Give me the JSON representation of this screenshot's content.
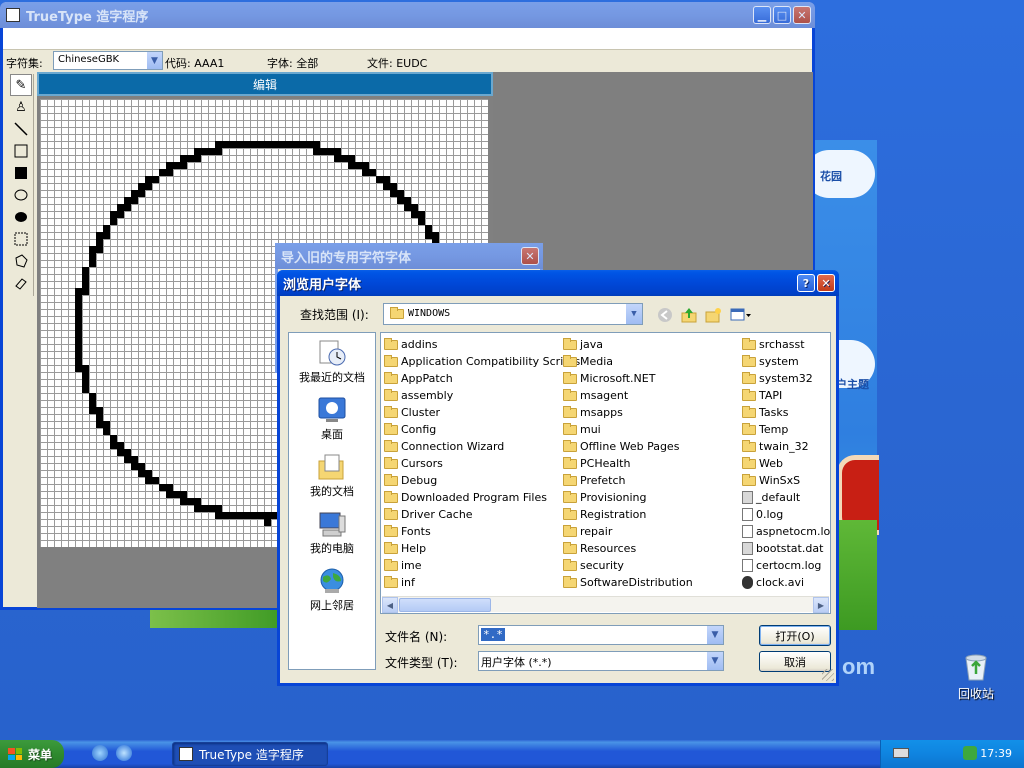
{
  "desktop": {
    "wallpaper_text_1": "花园",
    "wallpaper_text_2": "户主题",
    "wallpaper_brand": "om",
    "recycle_bin_label": "回收站"
  },
  "main_window": {
    "title": "TrueType 造字程序",
    "charset_label": "字符集:",
    "charset_value": "ChineseGBK",
    "code_label": "代码: AAA1",
    "font_label": "字体: 全部",
    "file_label": "文件: EUDC",
    "editor_header": "编辑",
    "tools": [
      "pencil-icon",
      "brush-icon",
      "line-icon",
      "hollow-rect-icon",
      "filled-rect-icon",
      "hollow-ellipse-icon",
      "filled-ellipse-icon",
      "rect-select-icon",
      "freeform-select-icon",
      "eraser-icon"
    ]
  },
  "import_dialog": {
    "title": "导入旧的专用字符字体"
  },
  "browse_dialog": {
    "title": "浏览用户字体",
    "look_in_label": "查找范围 (I):",
    "look_in_value": "WINDOWS",
    "places": [
      "我最近的文档",
      "桌面",
      "我的文档",
      "我的电脑",
      "网上邻居"
    ],
    "files": {
      "col1": [
        "addins",
        "Application Compatibility Scripts",
        "AppPatch",
        "assembly",
        "Cluster",
        "Config",
        "Connection Wizard",
        "Cursors",
        "Debug",
        "Downloaded Program Files",
        "Driver Cache",
        "Fonts",
        "Help",
        "ime",
        "inf"
      ],
      "col2": [
        "java",
        "Media",
        "Microsoft.NET",
        "msagent",
        "msapps",
        "mui",
        "Offline Web Pages",
        "PCHealth",
        "Prefetch",
        "Provisioning",
        "Registration",
        "repair",
        "Resources",
        "security",
        "SoftwareDistribution"
      ],
      "col3": [
        "srchasst",
        "system",
        "system32",
        "TAPI",
        "Tasks",
        "Temp",
        "twain_32",
        "Web",
        "WinSxS",
        "_default",
        "0.log",
        "aspnetocm.log",
        "bootstat.dat",
        "certocm.log",
        "clock.avi"
      ]
    },
    "filename_label": "文件名 (N):",
    "filename_value": "*.*",
    "filetype_label": "文件类型 (T):",
    "filetype_value": "用户字体 (*.*)",
    "open_button": "打开(O)",
    "cancel_button": "取消"
  },
  "taskbar": {
    "start_label": "菜单",
    "task_label": "TrueType 造字程序",
    "clock": "17:39"
  }
}
